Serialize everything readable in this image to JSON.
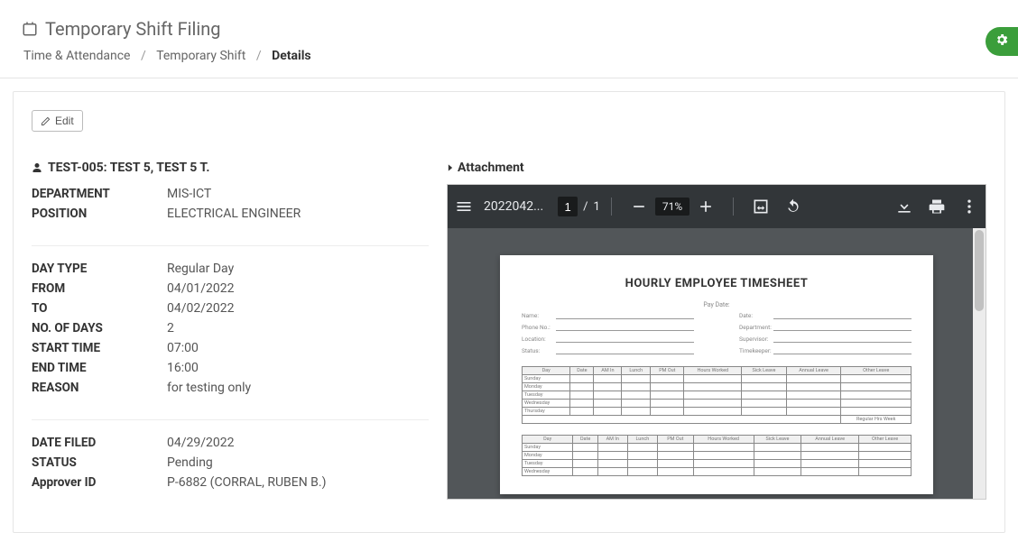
{
  "header": {
    "title": "Temporary Shift Filing",
    "breadcrumb": [
      "Time & Attendance",
      "Temporary Shift",
      "Details"
    ]
  },
  "actions": {
    "edit_label": "Edit"
  },
  "record": {
    "person_label": "TEST-005: TEST 5, TEST 5 T.",
    "group1": [
      {
        "label": "DEPARTMENT",
        "value": "MIS-ICT"
      },
      {
        "label": "POSITION",
        "value": "ELECTRICAL ENGINEER"
      }
    ],
    "group2": [
      {
        "label": "DAY TYPE",
        "value": "Regular Day"
      },
      {
        "label": "FROM",
        "value": "04/01/2022"
      },
      {
        "label": "TO",
        "value": "04/02/2022"
      },
      {
        "label": "NO. OF DAYS",
        "value": "2"
      },
      {
        "label": "START TIME",
        "value": "07:00"
      },
      {
        "label": "END TIME",
        "value": "16:00"
      },
      {
        "label": "REASON",
        "value": "for testing only"
      }
    ],
    "group3": [
      {
        "label": "DATE FILED",
        "value": "04/29/2022"
      },
      {
        "label": "STATUS",
        "value": "Pending"
      },
      {
        "label": "Approver ID",
        "value": "P-6882 (CORRAL, RUBEN B.)"
      }
    ]
  },
  "attachment": {
    "section_label": "Attachment",
    "pdf": {
      "filename": "2022042...",
      "page_current": "1",
      "page_sep": "/",
      "page_total": "1",
      "zoom": "71%",
      "document": {
        "title": "HOURLY EMPLOYEE TIMESHEET",
        "pay_label": "Pay Date:",
        "left_meta": [
          "Name:",
          "Phone No.:",
          "Location:",
          "Status:"
        ],
        "right_meta": [
          "Date:",
          "Department:",
          "Supervisor:",
          "Timekeeper:"
        ],
        "table_headers": [
          "Day",
          "Date",
          "AM In",
          "Lunch",
          "PM Out",
          "Hours Worked",
          "Sick Leave",
          "Annual Leave",
          "Other Leave"
        ],
        "days": [
          "Sunday",
          "Monday",
          "Tuesday",
          "Wednesday",
          "Thursday"
        ],
        "footer_label": "Regular Hrs Week",
        "days2": [
          "Sunday",
          "Monday",
          "Tuesday",
          "Wednesday"
        ]
      }
    }
  }
}
